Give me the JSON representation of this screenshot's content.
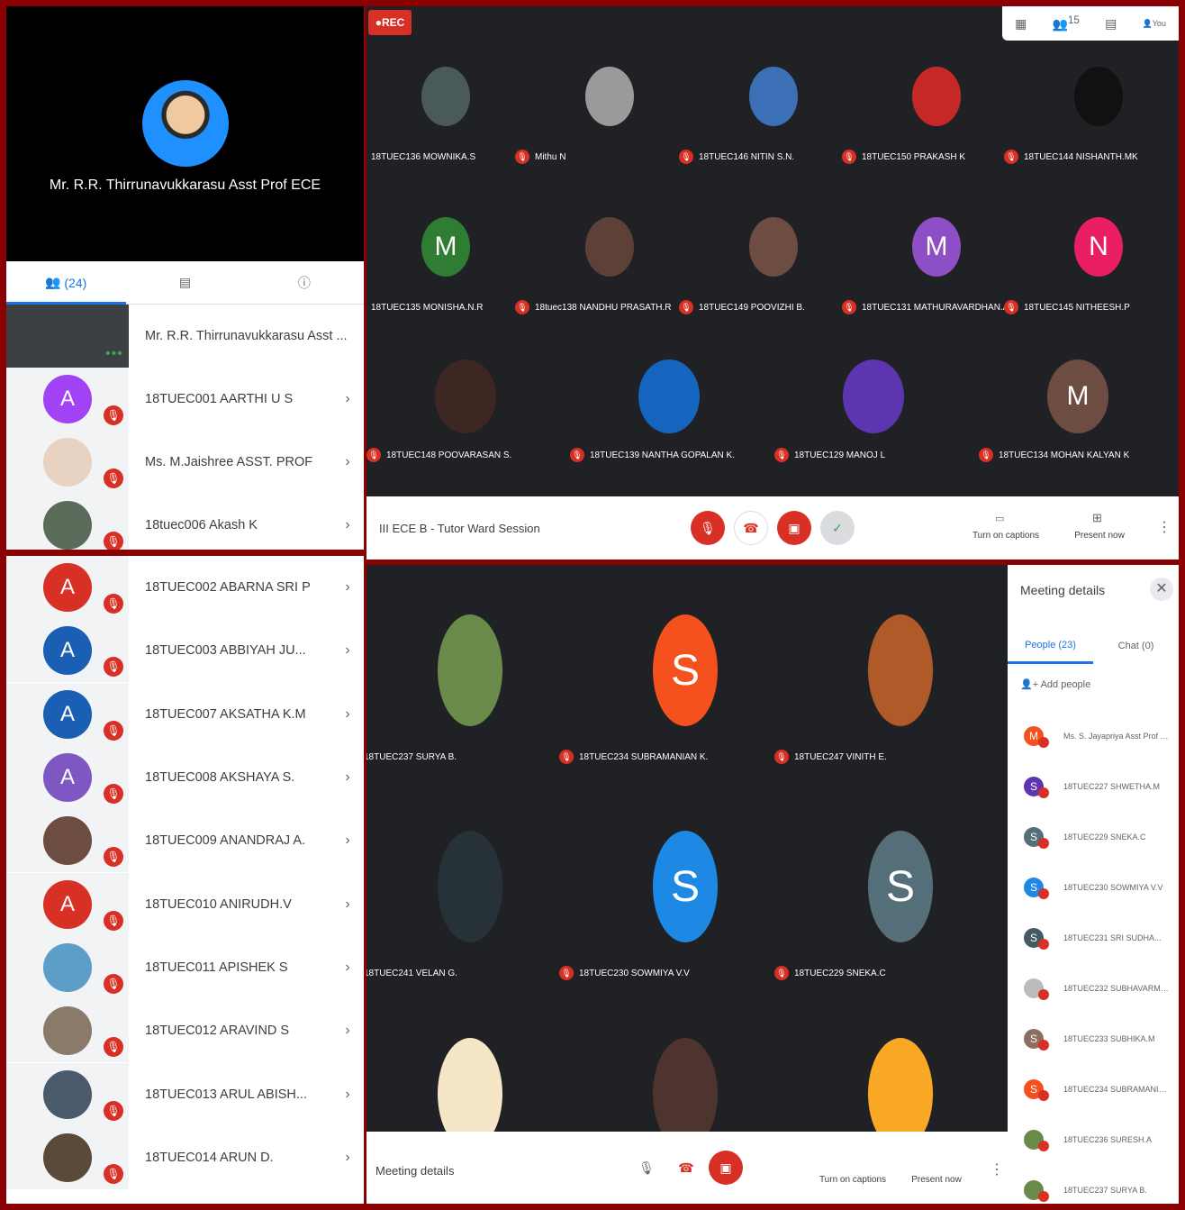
{
  "presenter": {
    "name": "Mr. R.R. Thirrunavukkarasu Asst Prof ECE"
  },
  "people_tabs": {
    "count": "(24)"
  },
  "top_list": [
    {
      "label": "Mr. R.R. Thirrunavukkarasu Asst ...",
      "initial": "",
      "color": "#3c4043",
      "host": true
    },
    {
      "label": "18TUEC001 AARTHI U S",
      "initial": "A",
      "color": "#a142f4"
    },
    {
      "label": "Ms. M.Jaishree ASST. PROF",
      "initial": "",
      "color": "#e8d3c3"
    },
    {
      "label": "18tuec006 Akash K",
      "initial": "",
      "color": "#5a6b5a"
    }
  ],
  "bottom_list": [
    {
      "label": "18TUEC002 ABARNA SRI P",
      "initial": "A",
      "color": "#d93025"
    },
    {
      "label": "18TUEC003 ABBIYAH JU...",
      "initial": "A",
      "color": "#1a5fb4"
    },
    {
      "label": "18TUEC007 AKSATHA K.M",
      "initial": "A",
      "color": "#1a5fb4"
    },
    {
      "label": "18TUEC008 AKSHAYA S.",
      "initial": "A",
      "color": "#7e57c2"
    },
    {
      "label": "18TUEC009 ANANDRAJ A.",
      "initial": "",
      "color": "#6d4c41"
    },
    {
      "label": "18TUEC010 ANIRUDH.V",
      "initial": "A",
      "color": "#d93025"
    },
    {
      "label": "18TUEC011 APISHEK S",
      "initial": "",
      "color": "#5c9ec7"
    },
    {
      "label": "18TUEC012 ARAVIND S",
      "initial": "",
      "color": "#8a7a6a"
    },
    {
      "label": "18TUEC013 ARUL ABISH...",
      "initial": "",
      "color": "#4a5a6a"
    },
    {
      "label": "18TUEC014 ARUN D.",
      "initial": "",
      "color": "#5a4a3a"
    }
  ],
  "meet_top": {
    "rec": "REC",
    "participants_badge": "15",
    "you_label": "You",
    "tiles": [
      {
        "name": "18TUEC136 MOWNIKA.S",
        "initial": "",
        "color": "#4a5a5a"
      },
      {
        "name": "Mithu N",
        "initial": "",
        "color": "#9a9a9a"
      },
      {
        "name": "18TUEC146 NITIN S.N.",
        "initial": "",
        "color": "#3b6fb6"
      },
      {
        "name": "18TUEC150 PRAKASH K",
        "initial": "",
        "color": "#c62828"
      },
      {
        "name": "18TUEC144 NISHANTH.MK",
        "initial": "",
        "color": "#111111"
      },
      {
        "name": "18TUEC135 MONISHA.N.R",
        "initial": "M",
        "color": "#2e7d32"
      },
      {
        "name": "18tuec138 NANDHU PRASATH.R",
        "initial": "",
        "color": "#5d4037"
      },
      {
        "name": "18TUEC149 POOVIZHI B.",
        "initial": "",
        "color": "#6d4c41"
      },
      {
        "name": "18TUEC131 MATHURAVARDHAN.A...",
        "initial": "M",
        "color": "#8e4ec6"
      },
      {
        "name": "18TUEC145 NITHEESH.P",
        "initial": "N",
        "color": "#e91e63"
      },
      {
        "name": "18TUEC148 POOVARASAN S.",
        "initial": "",
        "color": "#3e2723"
      },
      {
        "name": "18TUEC139 NANTHA GOPALAN K.",
        "initial": "",
        "color": "#1565c0"
      },
      {
        "name": "18TUEC129 MANOJ L",
        "initial": "",
        "color": "#5e35b1"
      },
      {
        "name": "18TUEC134 MOHAN KALYAN K",
        "initial": "M",
        "color": "#6d4c41"
      }
    ],
    "session_title": "III ECE B - Tutor Ward Session",
    "captions": "Turn on captions",
    "present": "Present now"
  },
  "meet_bottom": {
    "tiles": [
      {
        "name": "18TUEC237 SURYA B.",
        "initial": "",
        "color": "#6a8a4a"
      },
      {
        "name": "18TUEC234 SUBRAMANIAN K.",
        "initial": "S",
        "color": "#f4511e"
      },
      {
        "name": "18TUEC247 VINITH E.",
        "initial": "",
        "color": "#b05a2a"
      },
      {
        "name": "18TUEC241 VELAN G.",
        "initial": "",
        "color": "#263238"
      },
      {
        "name": "18TUEC230 SOWMIYA V.V",
        "initial": "S",
        "color": "#1e88e5"
      },
      {
        "name": "18TUEC229 SNEKA.C",
        "initial": "S",
        "color": "#546e7a"
      },
      {
        "name": "",
        "initial": "",
        "color": "#f5e6c8"
      },
      {
        "name": "",
        "initial": "",
        "color": "#4e342e"
      },
      {
        "name": "",
        "initial": "",
        "color": "#f9a825"
      }
    ],
    "meeting_details": "Meeting details",
    "captions": "Turn on captions",
    "present": "Present now",
    "side": {
      "title": "Meeting details",
      "people_tab": "People (23)",
      "chat_tab": "Chat (0)",
      "add_people": "Add people",
      "people": [
        {
          "name": "Ms. S. Jayapriya Asst Prof ECE (...",
          "initial": "M",
          "color": "#f4511e"
        },
        {
          "name": "18TUEC227 SHWETHA.M",
          "initial": "S",
          "color": "#5e35b1"
        },
        {
          "name": "18TUEC229 SNEKA.C",
          "initial": "S",
          "color": "#546e7a"
        },
        {
          "name": "18TUEC230 SOWMIYA V.V",
          "initial": "S",
          "color": "#1e88e5"
        },
        {
          "name": "18TUEC231 SRI SUDHA...",
          "initial": "S",
          "color": "#455a64"
        },
        {
          "name": "18TUEC232 SUBHAVARMAN R...",
          "initial": "",
          "color": "#bbbbbb"
        },
        {
          "name": "18TUEC233 SUBHIKA.M",
          "initial": "S",
          "color": "#8d6e63"
        },
        {
          "name": "18TUEC234 SUBRAMANIAN K.",
          "initial": "S",
          "color": "#f4511e"
        },
        {
          "name": "18TUEC236 SURESH.A",
          "initial": "",
          "color": "#6a8a4a"
        },
        {
          "name": "18TUEC237 SURYA B.",
          "initial": "",
          "color": "#6a8a4a"
        }
      ]
    }
  }
}
